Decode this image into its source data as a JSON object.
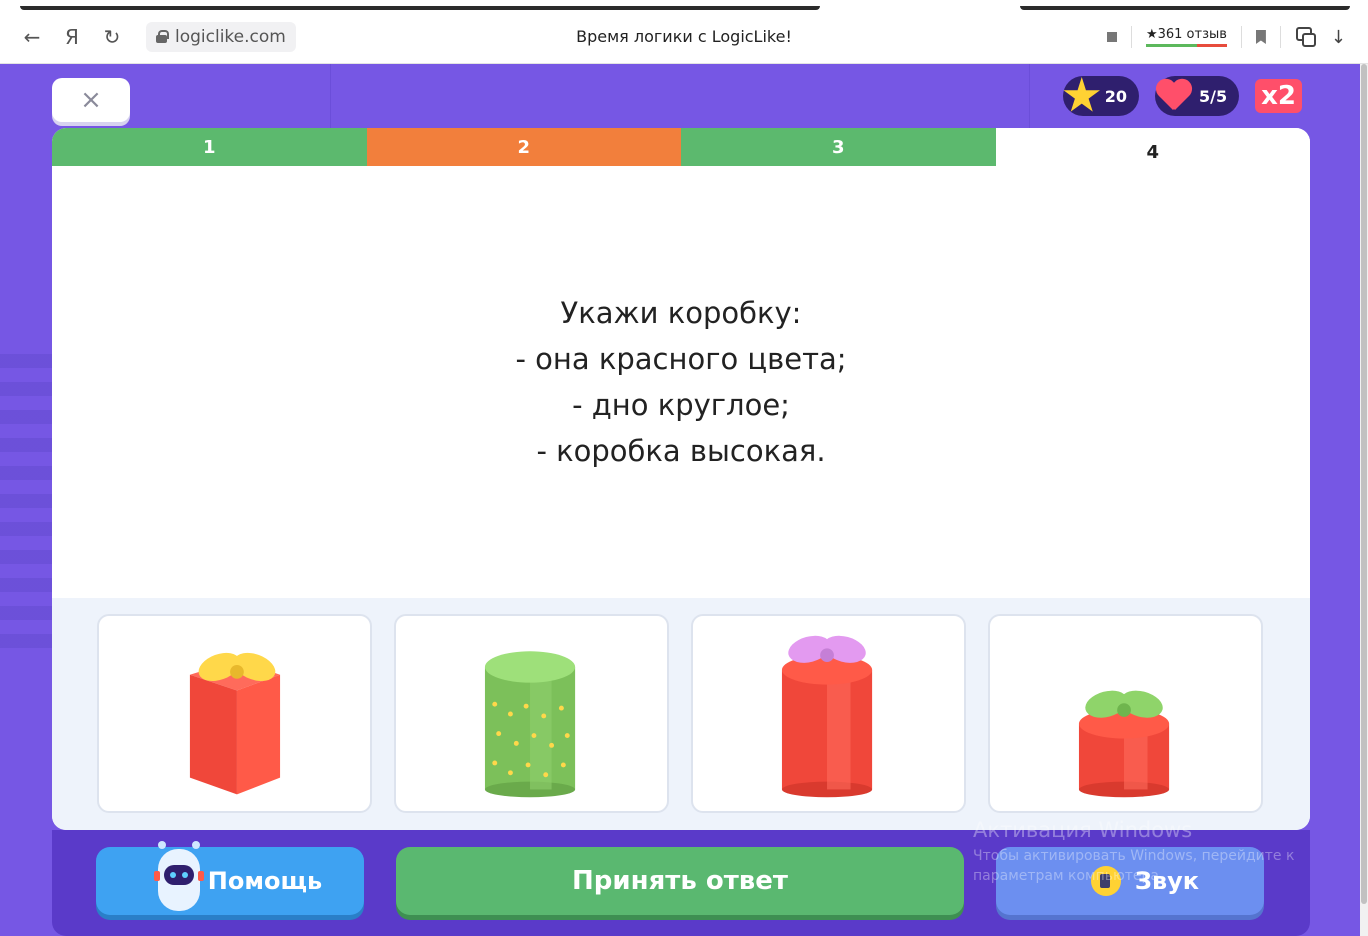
{
  "browser": {
    "back_glyph": "←",
    "yandex_glyph": "Я",
    "reload_glyph": "↻",
    "url": "logiclike.com",
    "page_title": "Время логики с LogicLike!",
    "reviews": "★361 отзыв",
    "download_glyph": "↓"
  },
  "top": {
    "close_glyph": "×",
    "stars": "20",
    "lives": "5/5",
    "multiplier": "x2"
  },
  "tabs": [
    {
      "label": "1",
      "state": "correct",
      "color": "#5cb96e"
    },
    {
      "label": "2",
      "state": "wrong",
      "color": "#f27f3c"
    },
    {
      "label": "3",
      "state": "correct",
      "color": "#5cb96e"
    },
    {
      "label": "4",
      "state": "current",
      "color": "#ffffff"
    }
  ],
  "question": {
    "lines": [
      "Укажи коробку:",
      "- она красного цвета;",
      "- дно круглое;",
      "- коробка высокая."
    ]
  },
  "options": [
    {
      "icon": "red-square-gift-box-icon"
    },
    {
      "icon": "green-dotted-round-box-icon"
    },
    {
      "icon": "red-tall-round-gift-box-icon"
    },
    {
      "icon": "red-short-round-gift-box-icon"
    }
  ],
  "bottom": {
    "help_label": "Помощь",
    "accept_label": "Принять ответ",
    "sound_label": "Звук"
  },
  "watermark": {
    "title": "Активация Windows",
    "text": "Чтобы активировать Windows, перейдите к параметрам компьютера."
  },
  "colors": {
    "background": "#7657e4",
    "correct": "#5cb96e",
    "wrong": "#f27f3c",
    "accept_button": "#5ab870",
    "help_button": "#3ea2f2"
  }
}
